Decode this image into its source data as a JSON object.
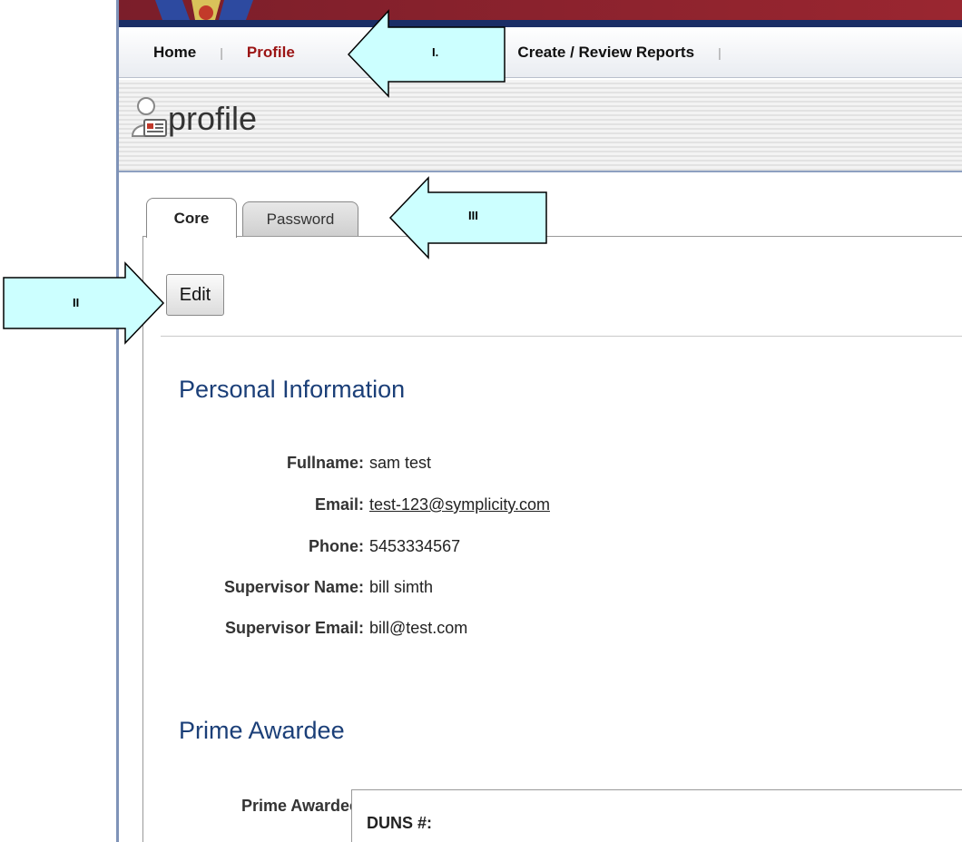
{
  "nav": {
    "items": [
      {
        "label": "Home",
        "active": false
      },
      {
        "label": "Profile",
        "active": true
      },
      {
        "label": "Create / Review Reports",
        "active": false
      }
    ],
    "separator": "|"
  },
  "header": {
    "title": "profile",
    "icon": "profile-card-icon"
  },
  "tabs": [
    {
      "label": "Core",
      "active": true
    },
    {
      "label": "Password",
      "active": false
    }
  ],
  "toolbar": {
    "edit_label": "Edit"
  },
  "personal": {
    "title": "Personal Information",
    "fields": [
      {
        "label": "Fullname:",
        "value": "sam test",
        "link": false
      },
      {
        "label": "Email:",
        "value": "test-123@symplicity.com",
        "link": true
      },
      {
        "label": "Phone:",
        "value": "5453334567",
        "link": false
      },
      {
        "label": "Supervisor Name:",
        "value": "bill simth",
        "link": false
      },
      {
        "label": "Supervisor Email:",
        "value": "bill@test.com",
        "link": false
      }
    ]
  },
  "prime": {
    "title": "Prime Awardee",
    "label": "Prime Awardee:",
    "duns_label": "DUNS #:"
  },
  "callouts": [
    {
      "label": "I."
    },
    {
      "label": "II"
    },
    {
      "label": "III"
    }
  ],
  "colors": {
    "active_nav": "#9b1414",
    "section_title": "#1b3f78",
    "callout_fill": "#ccffff"
  }
}
